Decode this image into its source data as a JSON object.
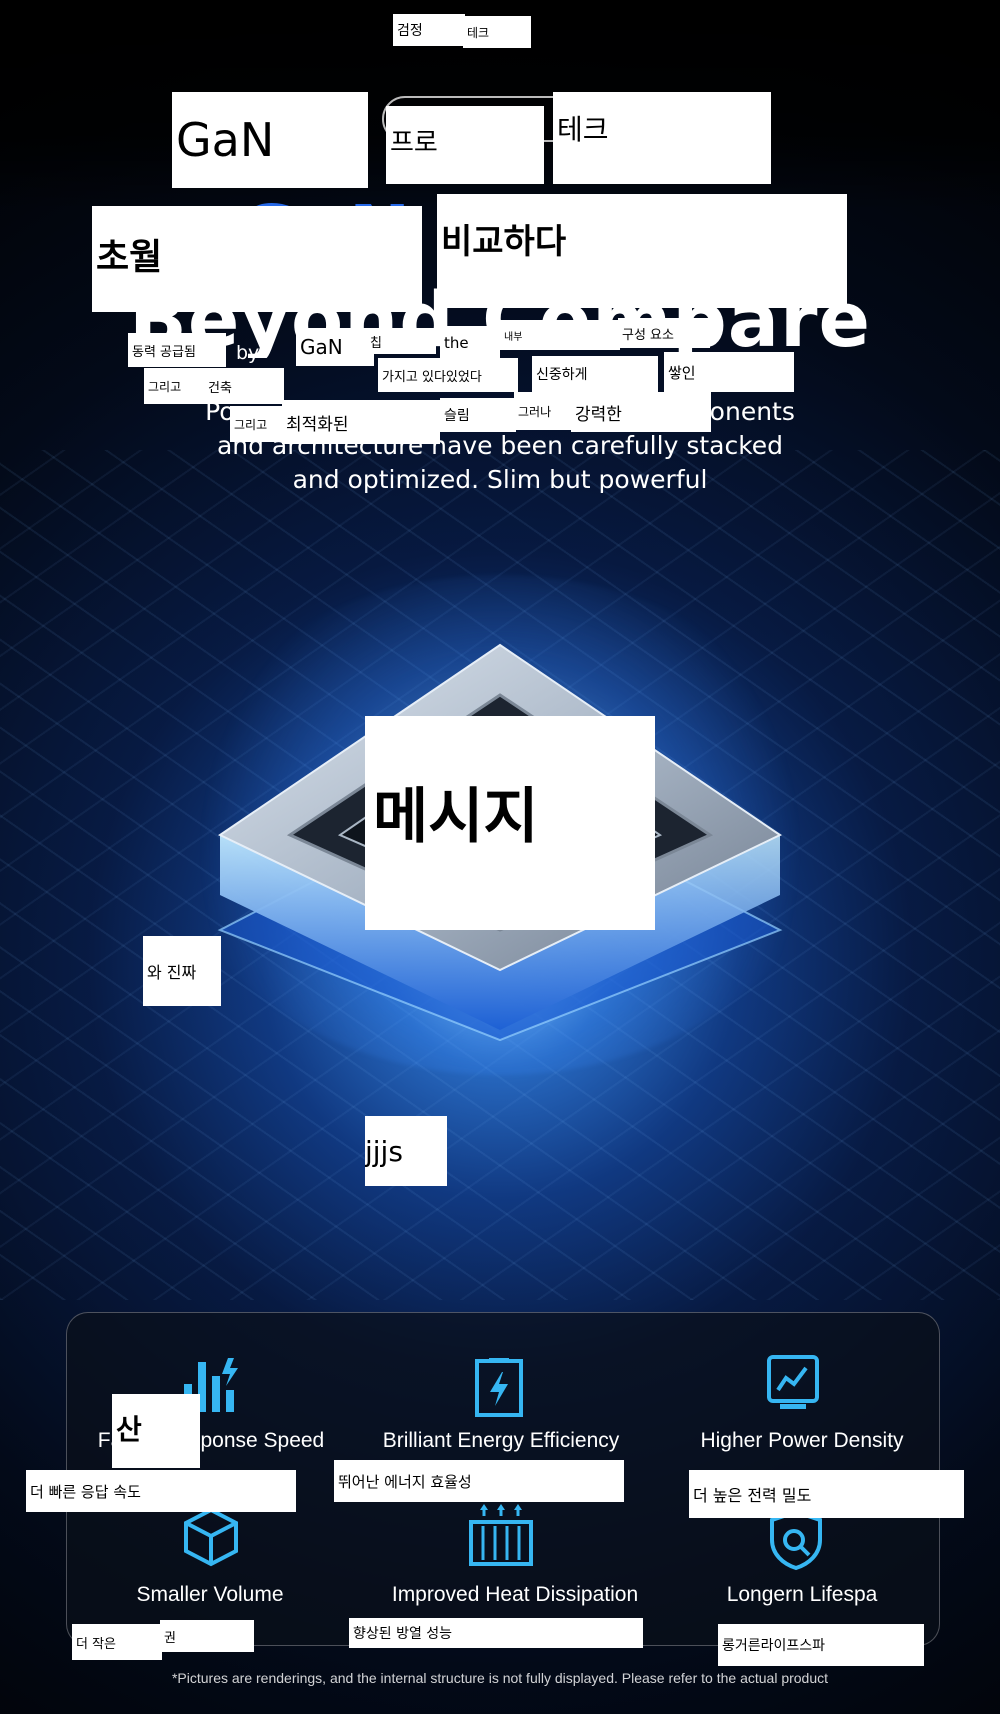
{
  "header": {
    "top_label_1": "검정",
    "top_label_2": "테크",
    "gan_label": "GaN",
    "pro_label": "프로",
    "tech_label": "테크",
    "ultra_label": "초월",
    "compare_label": "비교하다",
    "bg_title": "Beyond Compare",
    "bg_gan": "GaN"
  },
  "intro": {
    "w_power_supply": "동력 공급됨",
    "w_by": "by",
    "w_gan": "GaN",
    "w_chip": "칩",
    "w_the": "the",
    "w_internal": "내부",
    "w_components": "구성 요소",
    "w_and1": "그리고",
    "w_architecture": "건축",
    "w_have_been": "가지고 있다있었다",
    "w_carefully": "신중하게",
    "w_stacked": "쌓인",
    "w_and2": "그리고",
    "w_optimized": "최적화된",
    "w_slim": "슬림",
    "w_but": "그러나",
    "w_powerful": "강력한",
    "line1": "Powered by GaN chip, the internal components",
    "line2": "and architecture have been carefully stacked",
    "line3": "and optimized. Slim but powerful"
  },
  "chip_area": {
    "message_label": "메시지",
    "really_label": "와 진짜",
    "jjjs_label": "jjjs"
  },
  "features": [
    {
      "title": "Faster Response Speed",
      "title_overlay": "산",
      "caption": "더 빠른 응답 속도",
      "icon": "bar-chart-lightning-icon"
    },
    {
      "title": "Brilliant Energy Efficiency",
      "caption": "뛰어난 에너지 효율성",
      "icon": "lightning-battery-icon"
    },
    {
      "title": "Higher Power Density",
      "caption": "더 높은 전력 밀도",
      "icon": "line-chart-icon"
    },
    {
      "title": "Smaller Volume",
      "caption": "더 작은",
      "caption_extra": "권",
      "icon": "cube-icon"
    },
    {
      "title": "Improved Heat Dissipation",
      "caption": "향상된 방열 성능",
      "icon": "heat-sink-icon"
    },
    {
      "title": "Longern Lifespa",
      "caption": "롱거른라이프스파",
      "icon": "shield-search-icon"
    }
  ],
  "footnote": "*Pictures are renderings, and the internal structure is not fully displayed. Please refer to the actual product",
  "colors": {
    "accent_blue": "#2b74ff",
    "icon_cyan": "#36b6f2",
    "overlay_white": "#ffffff"
  }
}
